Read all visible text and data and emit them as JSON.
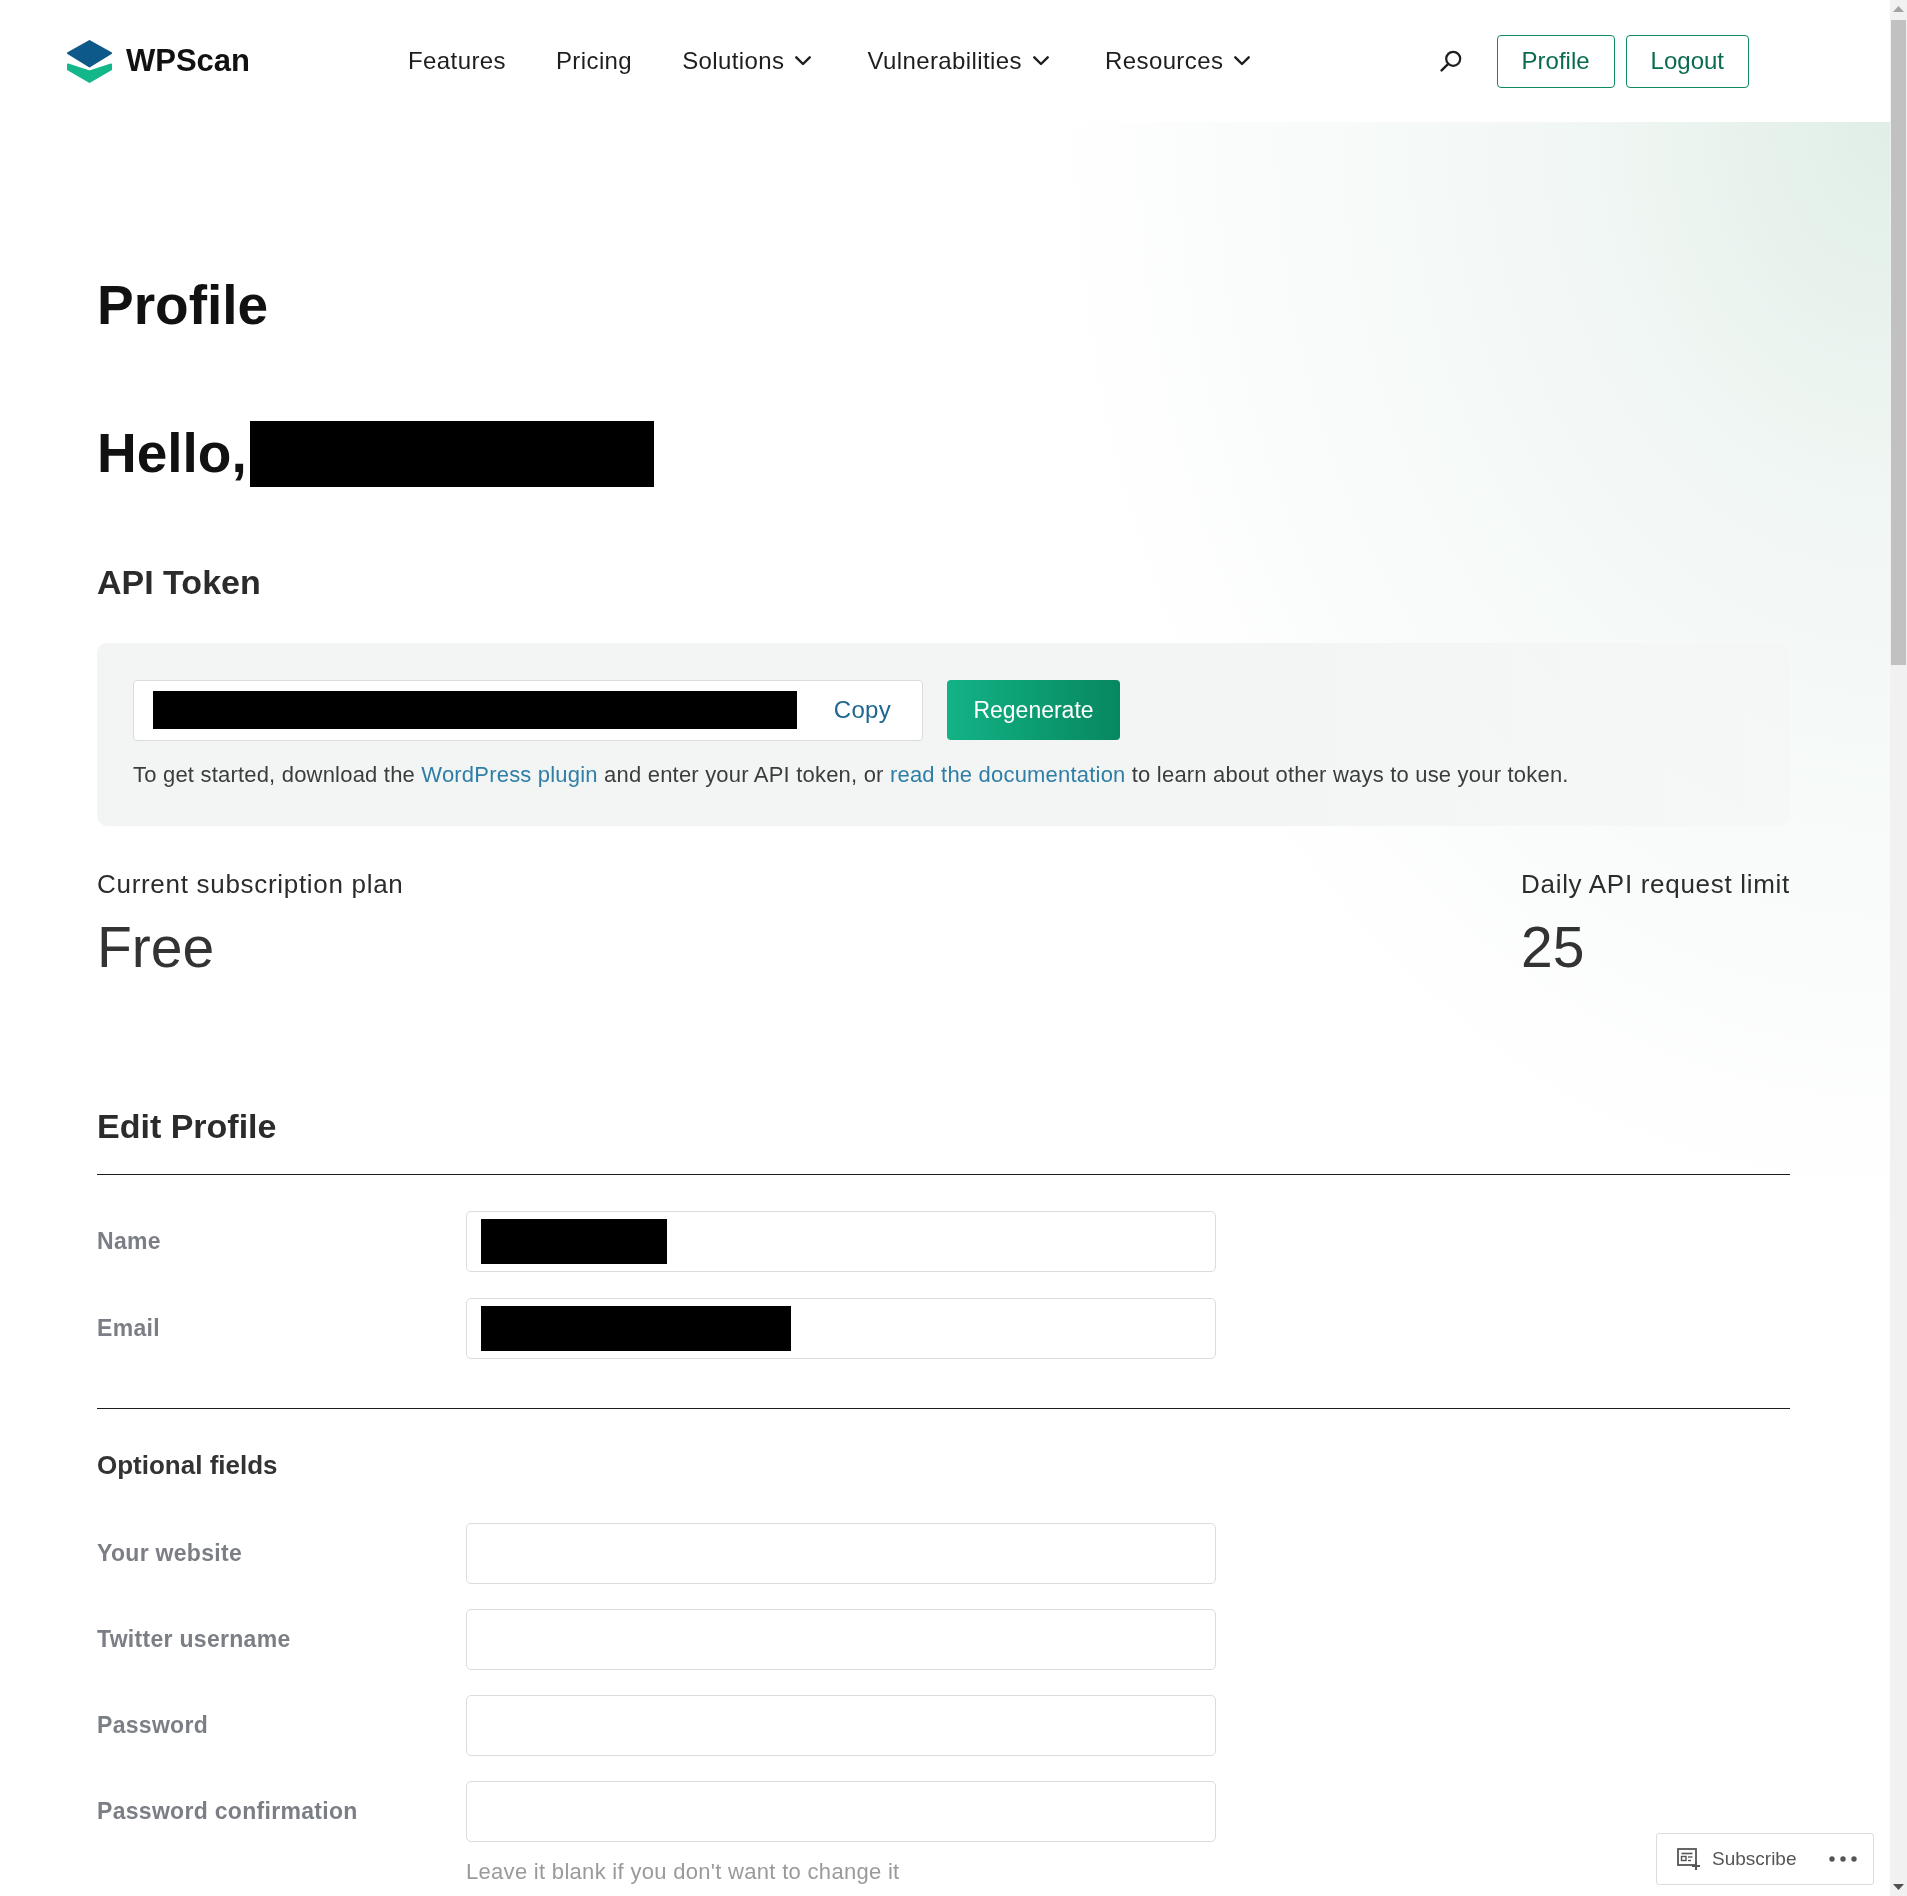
{
  "header": {
    "logo": "WPScan",
    "nav": [
      {
        "label": "Features",
        "dropdown": false
      },
      {
        "label": "Pricing",
        "dropdown": false
      },
      {
        "label": "Solutions",
        "dropdown": true
      },
      {
        "label": "Vulnerabilities",
        "dropdown": true
      },
      {
        "label": "Resources",
        "dropdown": true
      }
    ],
    "buttons": [
      "Profile",
      "Logout"
    ]
  },
  "title": "Profile",
  "greeting": {
    "text": "Hello,",
    "redacted": true
  },
  "api_token": {
    "heading": "API Token",
    "redacted": true,
    "copy": "Copy",
    "regenerate": "Regenerate",
    "help": [
      {
        "kind": "text",
        "text": "To get started, download the "
      },
      {
        "kind": "link",
        "text": "WordPress plugin"
      },
      {
        "kind": "text",
        "text": " and enter your API token, or "
      },
      {
        "kind": "link",
        "text": "read the documentation"
      },
      {
        "kind": "text",
        "text": " to learn about other ways to use your token."
      }
    ]
  },
  "stats": [
    {
      "label": "Current subscription plan",
      "value": "Free"
    },
    {
      "label": "Daily API request limit",
      "value": "25"
    }
  ],
  "edit_profile": {
    "heading": "Edit Profile",
    "fields": [
      {
        "label": "Name",
        "redacted": true
      },
      {
        "label": "Email",
        "redacted": true
      }
    ]
  },
  "optional_fields": {
    "heading": "Optional fields",
    "fields": [
      {
        "label": "Your website",
        "redacted": false
      },
      {
        "label": "Twitter username",
        "redacted": false
      },
      {
        "label": "Password",
        "redacted": false
      },
      {
        "label": "Password confirmation",
        "redacted": false
      }
    ],
    "hint": "Leave it blank if you don't want to change it"
  },
  "subscribe_bar": {
    "label": "Subscribe"
  }
}
